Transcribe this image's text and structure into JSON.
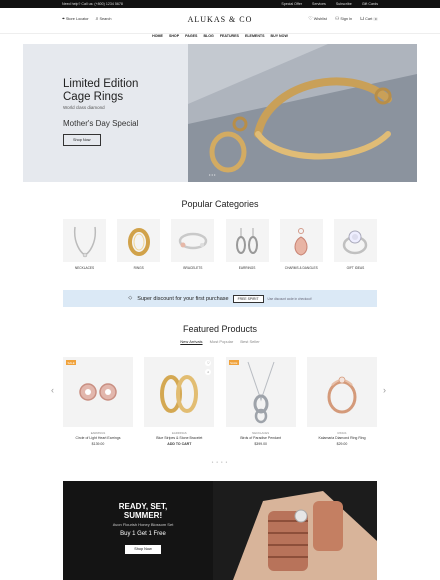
{
  "topbar": {
    "help": "Need help? Call us: (+800) 1234 5678",
    "links": [
      "Special Offer",
      "Services",
      "Subscribe",
      "Gift Cards"
    ]
  },
  "header": {
    "store_locator": "Store Locator",
    "search": "Search",
    "logo": "ALUKAS & CO",
    "wishlist": "Wishlist",
    "signin": "Sign In",
    "cart": "Cart",
    "cart_count": "0"
  },
  "nav": [
    "HOME",
    "SHOP",
    "PAGES",
    "BLOG",
    "FEATURES",
    "ELEMENTS",
    "BUY NOW"
  ],
  "hero": {
    "title_line1": "Limited Edition",
    "title_line2": "Cage Rings",
    "subtitle": "World class diamond",
    "occasion": "Mother's Day Special",
    "button": "Shop Now",
    "dots": "• • •"
  },
  "categories": {
    "title": "Popular Categories",
    "items": [
      {
        "label": "NECKLACES",
        "icon": "necklace-icon"
      },
      {
        "label": "RINGS",
        "icon": "ring-icon"
      },
      {
        "label": "BRACELETS",
        "icon": "bracelet-icon"
      },
      {
        "label": "EARRINGS",
        "icon": "earring-icon"
      },
      {
        "label": "CHARMS & DANGLES",
        "icon": "charm-icon"
      },
      {
        "label": "GIFT IDEAS",
        "icon": "gift-ring-icon"
      }
    ]
  },
  "promo": {
    "text": "Super discount for your first purchase",
    "code": "FREE SPIRIT",
    "note": "Use discount code in checkout!"
  },
  "featured": {
    "title": "Featured Products",
    "tabs": [
      "New Arrivals",
      "Most Popular",
      "Best Seller"
    ],
    "products": [
      {
        "tag": "SALE",
        "category": "EARRINGS",
        "name": "Circle of Light Heart Earrings",
        "price": "$139.00",
        "color": "#d9a6a0"
      },
      {
        "tag": "",
        "category": "EARRINGS",
        "name": "Blue Stripes & Stone Bracelet",
        "price": "ADD TO CART",
        "color": "#d4a852"
      },
      {
        "tag": "SALE",
        "category": "NECKLACES",
        "name": "Birds of Paradise Pendant",
        "price": "$399.00",
        "color": "#b8bcc2"
      },
      {
        "tag": "",
        "category": "RINGS",
        "name": "Kalamaria Diamond Ring Ring",
        "price": "$29.00",
        "color": "#d49a7a"
      }
    ],
    "dots": "● ● ● ●"
  },
  "banner": {
    "line1": "READY, SET,",
    "line2": "SUMMER!",
    "sub": "Avon Flourish Honey Blossom Set",
    "offer": "Buy 1 Get 1 Free",
    "button": "Shop Now"
  }
}
